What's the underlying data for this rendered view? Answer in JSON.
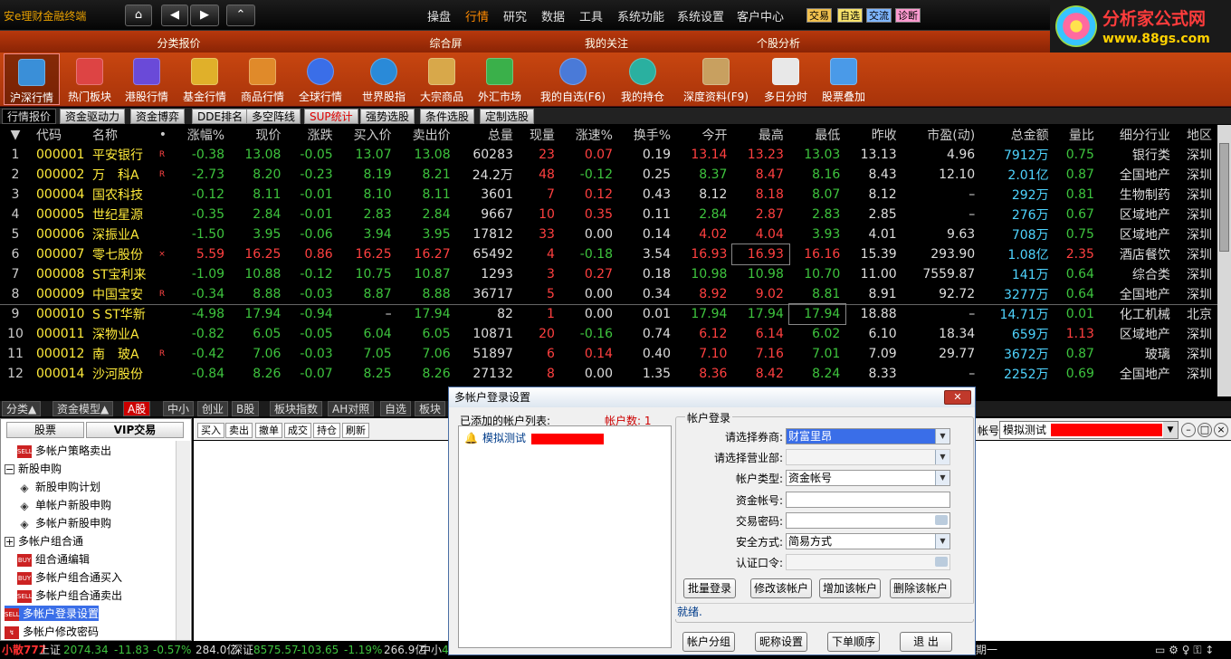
{
  "app": {
    "title": "安e理财金融终端"
  },
  "topnav": {
    "home": "⌂",
    "prev": "◀",
    "next": "▶",
    "up": "⌃"
  },
  "menu": [
    "操盘",
    "行情",
    "研究",
    "数据",
    "工具",
    "系统功能",
    "系统设置",
    "客户中心"
  ],
  "badges": [
    {
      "label": "交易",
      "color": "#f2c14e"
    },
    {
      "label": "自选",
      "color": "#f7e26b"
    },
    {
      "label": "交流",
      "color": "#7fb6ff"
    },
    {
      "label": "诊断",
      "color": "#ff9ad0"
    }
  ],
  "logo": {
    "name": "分析家公式网",
    "url": "www.88gs.com"
  },
  "categories": [
    "分类报价",
    "综合屏",
    "我的关注",
    "个股分析"
  ],
  "icons": [
    {
      "label": "沪深行情",
      "color": "#3a8fd8"
    },
    {
      "label": "热门板块",
      "color": "#d44"
    },
    {
      "label": "港股行情",
      "color": "#6a4ad8"
    },
    {
      "label": "基金行情",
      "color": "#e0b02a"
    },
    {
      "label": "商品行情",
      "color": "#e08a2a"
    },
    {
      "label": "全球行情",
      "color": "#3a6ee8"
    },
    {
      "label": "世界股指",
      "color": "#2a8ad8"
    },
    {
      "label": "大宗商品",
      "color": "#d8a84a"
    },
    {
      "label": "外汇市场",
      "color": "#3ab04a"
    },
    {
      "label": "我的自选(F6)",
      "color": "#4a7ad8"
    },
    {
      "label": "我的持仓",
      "color": "#2ab0a0"
    },
    {
      "label": "深度资料(F9)",
      "color": "#c8a060"
    },
    {
      "label": "多日分时",
      "color": "#e8e8e8"
    },
    {
      "label": "股票叠加",
      "color": "#4a9ae8"
    }
  ],
  "subtabs": [
    "行情报价",
    "资金驱动力",
    "资金博弈",
    "DDE排名",
    "多空阵线",
    "SUP统计",
    "强势选股",
    "条件选股",
    "定制选股"
  ],
  "quotes": {
    "headers": [
      "▼",
      "代码",
      "名称",
      "•",
      "涨幅%",
      "现价",
      "涨跌",
      "买入价",
      "卖出价",
      "总量",
      "现量",
      "涨速%",
      "换手%",
      "今开",
      "最高",
      "最低",
      "昨收",
      "市盈(动)",
      "总金额",
      "量比",
      "细分行业",
      "地区"
    ],
    "rows": [
      [
        "1",
        "000001",
        "平安银行",
        "R",
        "-0.38",
        "13.08",
        "-0.05",
        "13.07",
        "13.08",
        "60283",
        "23",
        "0.07",
        "0.19",
        "13.14",
        "13.23",
        "13.03",
        "13.13",
        "4.96",
        "7912万",
        "0.75",
        "银行类",
        "深圳"
      ],
      [
        "2",
        "000002",
        "万　科A",
        "R",
        "-2.73",
        "8.20",
        "-0.23",
        "8.19",
        "8.21",
        "24.2万",
        "48",
        "-0.12",
        "0.25",
        "8.37",
        "8.47",
        "8.16",
        "8.43",
        "12.10",
        "2.01亿",
        "0.87",
        "全国地产",
        "深圳"
      ],
      [
        "3",
        "000004",
        "国农科技",
        "",
        "-0.12",
        "8.11",
        "-0.01",
        "8.10",
        "8.11",
        "3601",
        "7",
        "0.12",
        "0.43",
        "8.12",
        "8.18",
        "8.07",
        "8.12",
        "–",
        "292万",
        "0.81",
        "生物制药",
        "深圳"
      ],
      [
        "4",
        "000005",
        "世纪星源",
        "",
        "-0.35",
        "2.84",
        "-0.01",
        "2.83",
        "2.84",
        "9667",
        "10",
        "0.35",
        "0.11",
        "2.84",
        "2.87",
        "2.83",
        "2.85",
        "–",
        "276万",
        "0.67",
        "区域地产",
        "深圳"
      ],
      [
        "5",
        "000006",
        "深振业A",
        "",
        "-1.50",
        "3.95",
        "-0.06",
        "3.94",
        "3.95",
        "17812",
        "33",
        "0.00",
        "0.14",
        "4.02",
        "4.04",
        "3.93",
        "4.01",
        "9.63",
        "708万",
        "0.75",
        "区域地产",
        "深圳"
      ],
      [
        "6",
        "000007",
        "零七股份",
        "×",
        "5.59",
        "16.25",
        "0.86",
        "16.25",
        "16.27",
        "65492",
        "4",
        "-0.18",
        "3.54",
        "16.93",
        "16.93",
        "16.16",
        "15.39",
        "293.90",
        "1.08亿",
        "2.35",
        "酒店餐饮",
        "深圳"
      ],
      [
        "7",
        "000008",
        "ST宝利来",
        "",
        "-1.09",
        "10.88",
        "-0.12",
        "10.75",
        "10.87",
        "1293",
        "3",
        "0.27",
        "0.18",
        "10.98",
        "10.98",
        "10.70",
        "11.00",
        "7559.87",
        "141万",
        "0.64",
        "综合类",
        "深圳"
      ],
      [
        "8",
        "000009",
        "中国宝安",
        "R",
        "-0.34",
        "8.88",
        "-0.03",
        "8.87",
        "8.88",
        "36717",
        "5",
        "0.00",
        "0.34",
        "8.92",
        "9.02",
        "8.81",
        "8.91",
        "92.72",
        "3277万",
        "0.64",
        "全国地产",
        "深圳"
      ],
      [
        "9",
        "000010",
        "S ST华新",
        "",
        "-4.98",
        "17.94",
        "-0.94",
        "–",
        "17.94",
        "82",
        "1",
        "0.00",
        "0.01",
        "17.94",
        "17.94",
        "17.94",
        "18.88",
        "–",
        "14.71万",
        "0.01",
        "化工机械",
        "北京"
      ],
      [
        "10",
        "000011",
        "深物业A",
        "",
        "-0.82",
        "6.05",
        "-0.05",
        "6.04",
        "6.05",
        "10871",
        "20",
        "-0.16",
        "0.74",
        "6.12",
        "6.14",
        "6.02",
        "6.10",
        "18.34",
        "659万",
        "1.13",
        "区域地产",
        "深圳"
      ],
      [
        "11",
        "000012",
        "南　玻A",
        "R",
        "-0.42",
        "7.06",
        "-0.03",
        "7.05",
        "7.06",
        "51897",
        "6",
        "0.14",
        "0.40",
        "7.10",
        "7.16",
        "7.01",
        "7.09",
        "29.77",
        "3672万",
        "0.87",
        "玻璃",
        "深圳"
      ],
      [
        "12",
        "000014",
        "沙河股份",
        "",
        "-0.84",
        "8.26",
        "-0.07",
        "8.25",
        "8.26",
        "27132",
        "8",
        "0.00",
        "1.35",
        "8.36",
        "8.42",
        "8.24",
        "8.33",
        "–",
        "2252万",
        "0.69",
        "全国地产",
        "深圳"
      ]
    ]
  },
  "bottom_tabs": [
    "分类▲",
    "资金模型▲",
    "A股",
    "中小",
    "创业",
    "B股",
    "板块指数",
    "AH对照",
    "自选",
    "板块"
  ],
  "left_panel": {
    "tabs": [
      "股票",
      "VIP交易"
    ],
    "items": [
      {
        "label": "多帐户策略卖出",
        "icon": "SELL"
      },
      {
        "label": "新股申购",
        "icon": "−"
      },
      {
        "label": "新股申购计划",
        "icon": "◈"
      },
      {
        "label": "单帐户新股申购",
        "icon": "◈"
      },
      {
        "label": "多帐户新股申购",
        "icon": "◈"
      },
      {
        "label": "多帐户组合通",
        "icon": "+"
      },
      {
        "label": "组合通编辑",
        "icon": "BUY"
      },
      {
        "label": "多帐户组合通买入",
        "icon": "BUY"
      },
      {
        "label": "多帐户组合通卖出",
        "icon": "SELL"
      },
      {
        "label": "多帐户登录设置",
        "icon": "SELL"
      },
      {
        "label": "多帐户修改密码",
        "icon": "↯"
      }
    ]
  },
  "trade_toolbar": [
    "买入",
    "卖出",
    "撤单",
    "成交",
    "持仓",
    "刷新"
  ],
  "account_selector": {
    "label": "帐号",
    "value": "模拟测试"
  },
  "statusbar": {
    "left": "小散777",
    "sh": "上证",
    "sh_val": "2074.34",
    "sh_chg": "-11.83",
    "sh_pct": "-0.57%",
    "sh_amt": "284.0亿",
    "sz": "深证",
    "sz_val": "8575.57",
    "sz_chg": "-103.65",
    "sz_pct": "-1.19%",
    "sz_amt": "266.9亿",
    "zx": "中小",
    "zx_val": "4",
    "right": "期一"
  },
  "dialog": {
    "title": "多帐户登录设置",
    "list_label": "已添加的帐户列表:",
    "count_label": "帐户数: 1",
    "account_name": "模拟测试",
    "group_title": "帐户登录",
    "fields": [
      {
        "label": "请选择券商:",
        "value": "财富里昂"
      },
      {
        "label": "请选择营业部:",
        "value": ""
      },
      {
        "label": "帐户类型:",
        "value": "资金帐号"
      },
      {
        "label": "资金帐号:",
        "value": ""
      },
      {
        "label": "交易密码:",
        "value": ""
      },
      {
        "label": "安全方式:",
        "value": "简易方式"
      },
      {
        "label": "认证口令:",
        "value": ""
      }
    ],
    "group_buttons": [
      "批量登录",
      "修改该帐户",
      "增加该帐户",
      "删除该帐户"
    ],
    "status": "就绪.",
    "footer_buttons": [
      "帐户分组",
      "昵称设置",
      "下单顺序",
      "退 出"
    ]
  }
}
